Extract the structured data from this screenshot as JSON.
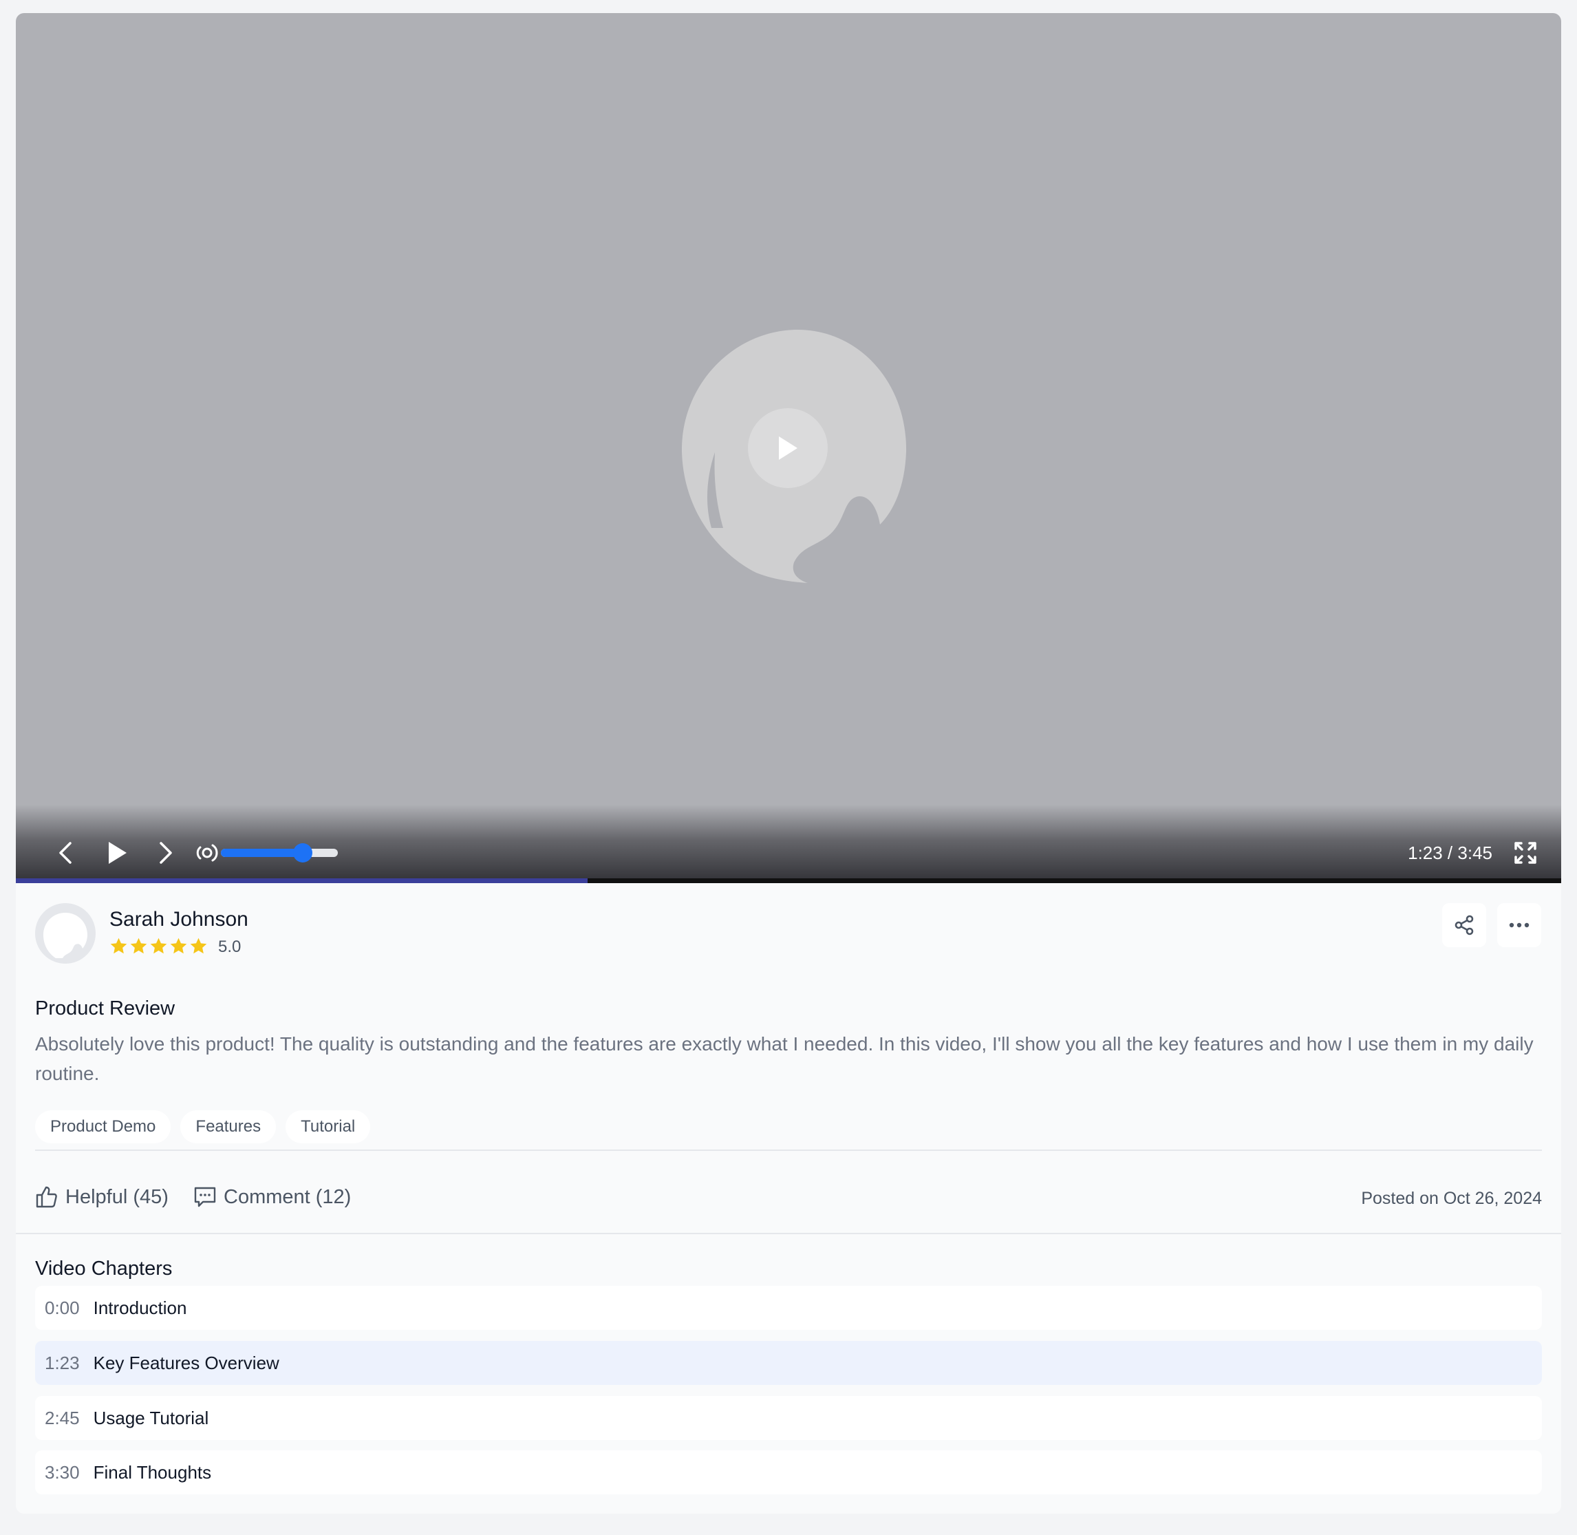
{
  "player": {
    "time_display": "1:23 / 3:45",
    "playback_progress": 0.37,
    "volume_level": 0.7
  },
  "review": {
    "author": "Sarah Johnson",
    "rating_value": "5.0",
    "stars": 5,
    "title": "Product Review",
    "body": "Absolutely love this product! The quality is outstanding and the features are exactly what I needed. In this video, I'll show you all the key features and how I use them in my daily routine.",
    "tags": [
      "Product Demo",
      "Features",
      "Tutorial"
    ],
    "helpful_label": "Helpful (45)",
    "comment_label": "Comment (12)",
    "posted": "Posted on Oct 26, 2024"
  },
  "chapters": {
    "title": "Video Chapters",
    "items": [
      {
        "time": "0:00",
        "title": "Introduction"
      },
      {
        "time": "1:23",
        "title": "Key Features Overview",
        "active": true
      },
      {
        "time": "2:45",
        "title": "Usage Tutorial"
      },
      {
        "time": "3:30",
        "title": "Final Thoughts"
      }
    ]
  },
  "colors": {
    "accent": "#1d72f5",
    "star": "#f5c518",
    "active_chapter_bg": "#edf2fd"
  },
  "icons": {
    "prev": "chevron-left-icon",
    "play": "play-icon",
    "next": "chevron-right-icon",
    "volume": "volume-icon",
    "fullscreen": "fullscreen-icon",
    "share": "share-icon",
    "more": "more-horizontal-icon",
    "helpful": "thumbs-up-icon",
    "comment": "comment-icon"
  }
}
